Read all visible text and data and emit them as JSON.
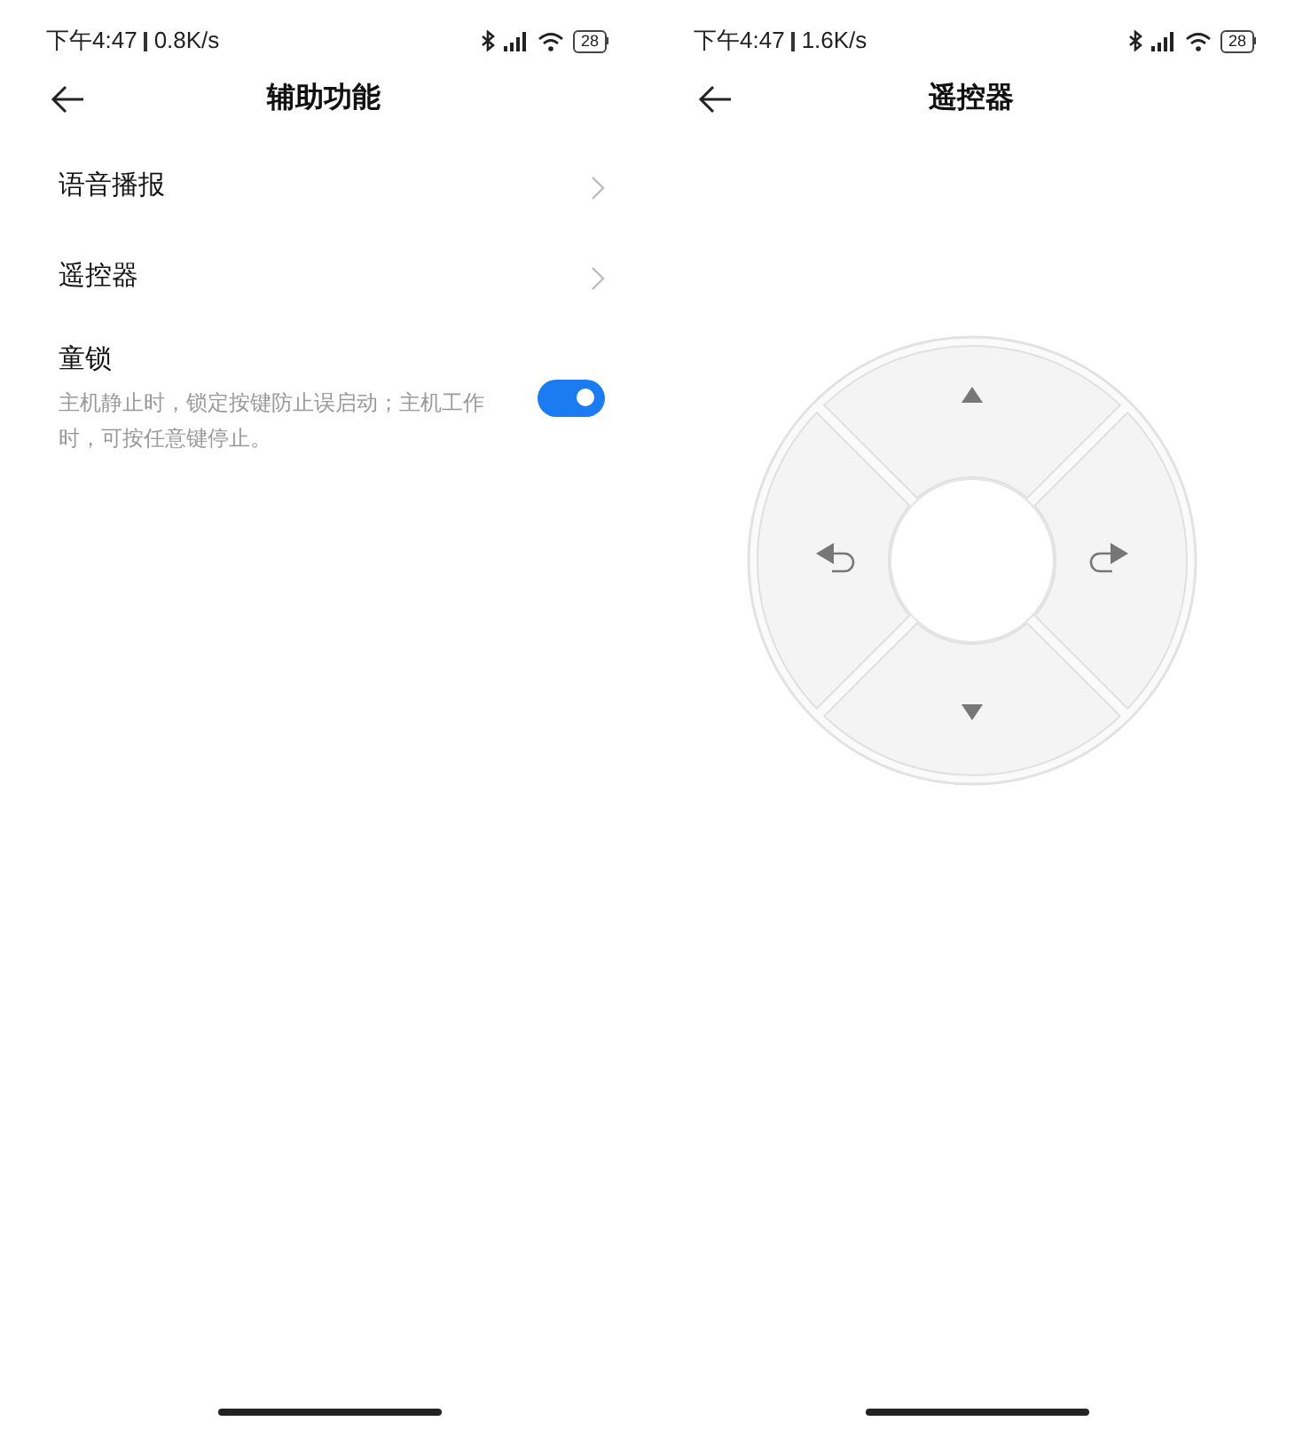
{
  "screens": [
    {
      "kind": "settings",
      "status_bar": {
        "time": "下午4:47",
        "speed": "0.8K/s",
        "battery": "28"
      },
      "title": "辅助功能",
      "items": [
        {
          "kind": "link",
          "label": "语音播报"
        },
        {
          "kind": "link",
          "label": "遥控器"
        },
        {
          "kind": "toggle",
          "label": "童锁",
          "description": "主机静止时，锁定按键防止误启动；主机工作时，可按任意键停止。",
          "on": true
        }
      ]
    },
    {
      "kind": "remote",
      "status_bar": {
        "time": "下午4:47",
        "speed": "1.6K/s",
        "battery": "28"
      },
      "title": "遥控器"
    }
  ]
}
